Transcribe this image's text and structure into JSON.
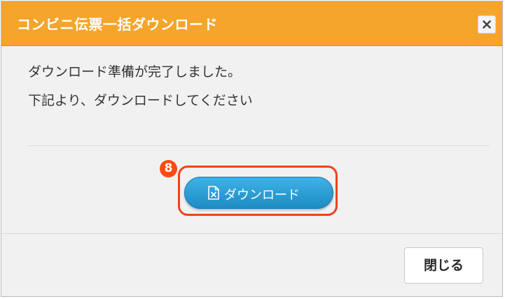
{
  "dialog": {
    "title": "コンビニ伝票一括ダウンロード",
    "close_icon": "close-icon"
  },
  "message": {
    "line1": "ダウンロード準備が完了しました。",
    "line2": "下記より、ダウンロードしてください"
  },
  "annotation": {
    "step_number": "8"
  },
  "download_button": {
    "label": "ダウンロード",
    "icon": "excel-file-icon"
  },
  "footer": {
    "close_label": "閉じる"
  },
  "colors": {
    "header": "#f5a52b",
    "button": "#2a9fd8",
    "highlight": "#f0421c"
  }
}
